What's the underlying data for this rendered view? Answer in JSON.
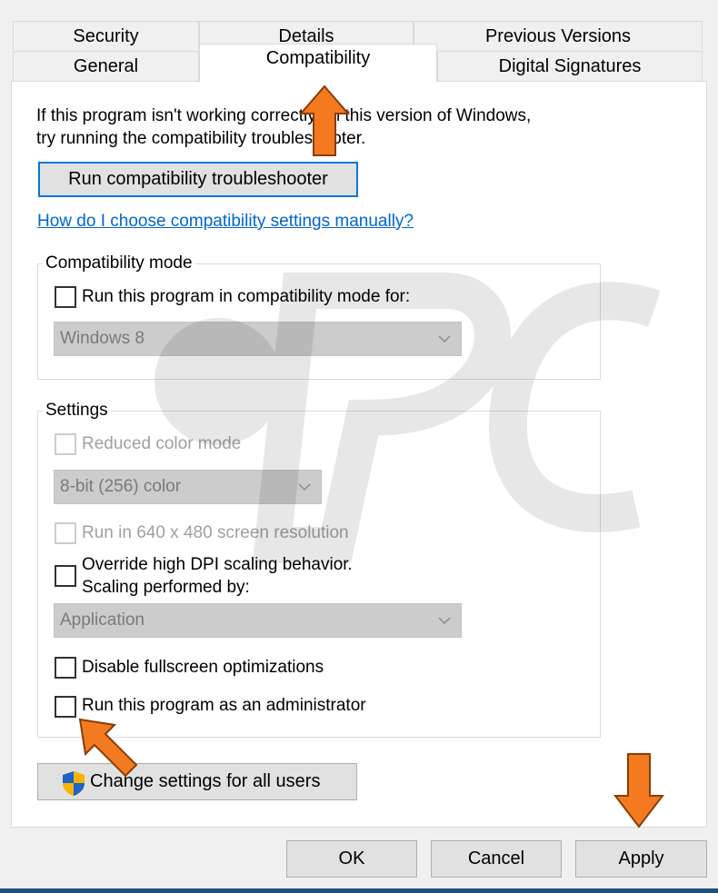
{
  "tabs": {
    "row_back": [
      "Security",
      "Details",
      "Previous Versions"
    ],
    "row_front": [
      "General",
      "Compatibility",
      "Digital Signatures"
    ],
    "active": "Compatibility"
  },
  "intro": {
    "line1": "If this program isn't working correctly on this version of Windows,",
    "line2": "try running the compatibility troubleshooter."
  },
  "troubleshooter_button": "Run compatibility troubleshooter",
  "manual_link": "How do I choose compatibility settings manually?",
  "compat_mode": {
    "legend": "Compatibility mode",
    "checkbox_label": "Run this program in compatibility mode for:",
    "checked": false,
    "os_selected": "Windows 8"
  },
  "settings": {
    "legend": "Settings",
    "reduced_color": {
      "label": "Reduced color mode",
      "checked": false,
      "enabled": false
    },
    "color_selected": "8-bit (256) color",
    "res640": {
      "label": "Run in 640 x 480 screen resolution",
      "checked": false,
      "enabled": false
    },
    "dpi": {
      "label_line1": "Override high DPI scaling behavior.",
      "label_line2": "Scaling performed by:",
      "checked": false
    },
    "scaling_selected": "Application",
    "fullscreen": {
      "label": "Disable fullscreen optimizations",
      "checked": false
    },
    "admin": {
      "label": "Run this program as an administrator",
      "checked": false
    }
  },
  "change_all_users_button": "Change settings for all users",
  "footer": {
    "ok": "OK",
    "cancel": "Cancel",
    "apply": "Apply"
  },
  "colors": {
    "accent": "#0078d7",
    "link": "#0066cc",
    "arrow": "#f47a20"
  },
  "icons": [
    "shield-icon",
    "chevron-down-icon",
    "arrow-up-icon",
    "arrow-down-icon"
  ]
}
